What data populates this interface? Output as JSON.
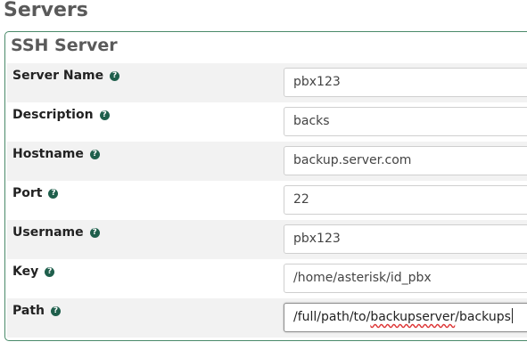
{
  "page": {
    "title": "Servers"
  },
  "section": {
    "legend": "SSH Server"
  },
  "fields": [
    {
      "label": "Server Name",
      "value": "pbx123"
    },
    {
      "label": "Description",
      "value": "backs"
    },
    {
      "label": "Hostname",
      "value": "backup.server.com"
    },
    {
      "label": "Port",
      "value": "22"
    },
    {
      "label": "Username",
      "value": "pbx123"
    },
    {
      "label": "Key",
      "value": "/home/asterisk/id_pbx"
    },
    {
      "label": "Path",
      "value_prefix": "/full/path/to/",
      "value_misspelled": "backupserver",
      "value_suffix": "/backups"
    }
  ],
  "icons": {
    "help": "question-circle-icon"
  },
  "colors": {
    "help_icon": "#1f5f4c",
    "border": "#4a8a6a"
  }
}
